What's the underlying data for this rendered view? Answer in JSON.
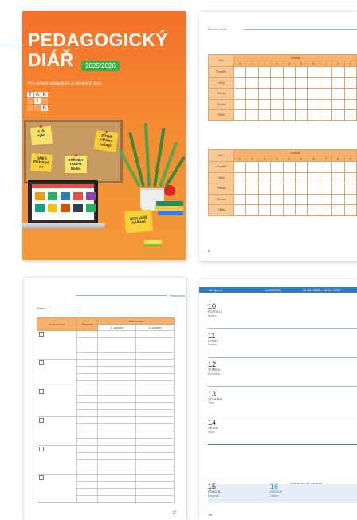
{
  "cover": {
    "title_line1": "PEDAGOGICKÝ",
    "title_line2": "DIÁŘ",
    "year": "2025/2026",
    "subtitle": "Pro učitele základních a středních škol",
    "logo_letters": [
      "T",
      "A",
      "K",
      "",
      "I",
      "",
      "",
      "",
      "K"
    ],
    "notes": [
      "4. B\nvýlet",
      "DNES\nPORADA\n!!!",
      "STŘEDA\nrozvrh\nhodin",
      "ZÍTRA\nvšichni\nsešity!"
    ],
    "card": "NEJLEPŠÍ\nNÁŘADÍ",
    "colors": {
      "cover_orange": "#f4712a",
      "badge_green": "#3fae49"
    }
  },
  "schedule_page": {
    "running_title": "Rozvrh hodin",
    "page_number": "8",
    "table_header": {
      "day": "Den",
      "hour": "Hodina"
    },
    "hours": [
      "0",
      "1",
      "2",
      "3",
      "4",
      "5",
      "6",
      "7",
      "8",
      "9"
    ],
    "days": [
      "Pondělí",
      "Úterý",
      "Středa",
      "Čtvrtek",
      "Pátek"
    ],
    "colors": {
      "header": "#f6b26b",
      "accent_blue": "#2f80c3"
    }
  },
  "grades_page": {
    "running_title": "Hodnocení",
    "class_label": "Třída:",
    "page_number": "17",
    "columns": {
      "name": "Jméno žáka",
      "subject": "Předmět",
      "grading": "Hodnocení",
      "first_half": "1. pololetí",
      "second_half": "2. pololetí"
    },
    "student_rows": 6
  },
  "week_page": {
    "week_label": "46. týden",
    "month": "LISTOPAD",
    "range": "10. 11. 2025 – 16. 11. 2025",
    "page_number": "78",
    "days": [
      {
        "num": "10",
        "name": "PONDĚLÍ",
        "nameday": "Evžen"
      },
      {
        "num": "11",
        "name": "ÚTERÝ",
        "nameday": "Martin"
      },
      {
        "num": "12",
        "name": "STŘEDA",
        "nameday": "Benedikt"
      },
      {
        "num": "13",
        "name": "ČTVRTEK",
        "nameday": "Tibor"
      },
      {
        "num": "14",
        "name": "PÁTEK",
        "nameday": "Sáva"
      },
      {
        "num": "15",
        "name": "SOBOTA",
        "nameday": "Leopold"
      },
      {
        "num": "16",
        "name": "NEDĚLE",
        "nameday": "Otmar"
      }
    ],
    "holiday_note": "Mezinárodní den tolerance"
  }
}
